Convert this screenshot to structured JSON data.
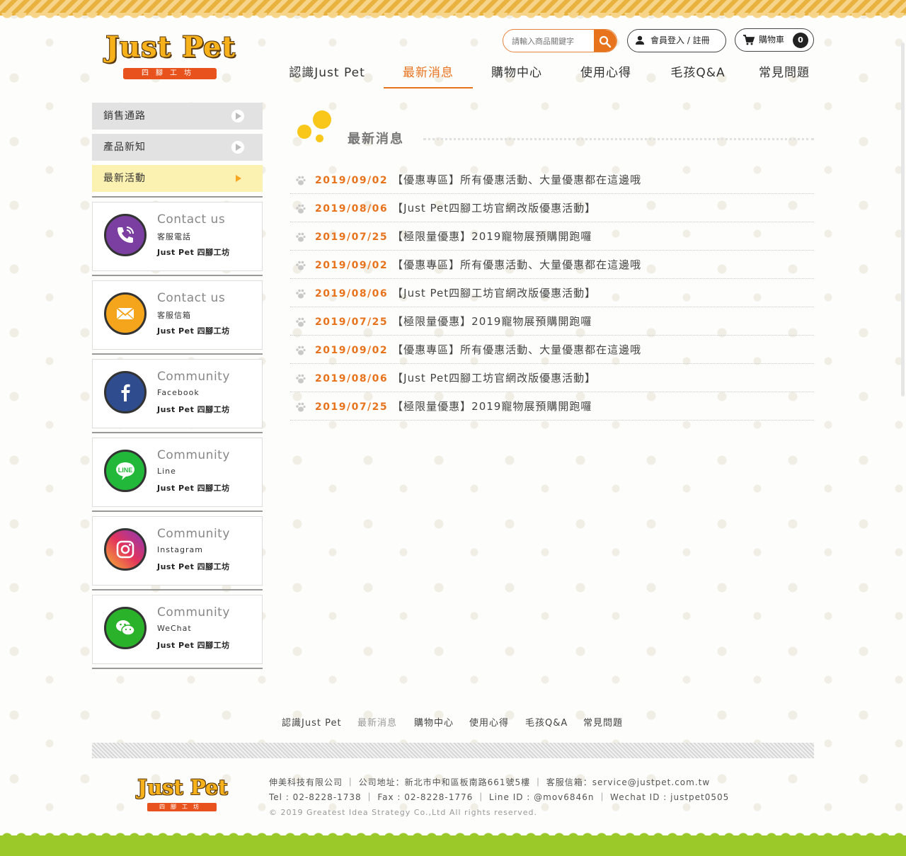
{
  "brand": {
    "logo_text": "Just Pet",
    "logo_sub": "四腳工坊"
  },
  "header": {
    "search_placeholder": "請輸入商品關鍵字",
    "login_label": "會員登入 / 註冊",
    "cart_label": "購物車",
    "cart_count": "0"
  },
  "nav": {
    "items": [
      {
        "label": "認識Just Pet"
      },
      {
        "label": "最新消息",
        "active": true
      },
      {
        "label": "購物中心"
      },
      {
        "label": "使用心得"
      },
      {
        "label": "毛孩Q&A"
      },
      {
        "label": "常見問題"
      }
    ]
  },
  "sidebar": {
    "items": [
      {
        "label": "銷售通路"
      },
      {
        "label": "產品新知"
      },
      {
        "label": "最新活動",
        "active": true
      }
    ],
    "cards": [
      {
        "title": "Contact us",
        "sub": "客服電話",
        "brand": "Just Pet 四腳工坊",
        "icon": "phone-icon",
        "color": "#7a3fa0"
      },
      {
        "title": "Contact us",
        "sub": "客服信箱",
        "brand": "Just Pet 四腳工坊",
        "icon": "mail-icon",
        "color": "#f5a51c"
      },
      {
        "title": "Community",
        "sub": "Facebook",
        "brand": "Just Pet 四腳工坊",
        "icon": "facebook-icon",
        "color": "#2f4c8e"
      },
      {
        "title": "Community",
        "sub": "Line",
        "brand": "Just Pet 四腳工坊",
        "icon": "line-icon",
        "color": "#22b83a"
      },
      {
        "title": "Community",
        "sub": "Instagram",
        "brand": "Just Pet 四腳工坊",
        "icon": "instagram-icon",
        "color": "#d6336c"
      },
      {
        "title": "Community",
        "sub": "WeChat",
        "brand": "Just Pet 四腳工坊",
        "icon": "wechat-icon",
        "color": "#2ab22a"
      }
    ]
  },
  "content": {
    "section_title": "最新消息",
    "news": [
      {
        "date": "2019/09/02",
        "title": "【優惠專區】所有優惠活動、大量優惠都在這邊哦"
      },
      {
        "date": "2019/08/06",
        "title": "【Just Pet四腳工坊官網改版優惠活動】"
      },
      {
        "date": "2019/07/25",
        "title": "【極限量優惠】2019寵物展預購開跑囉"
      },
      {
        "date": "2019/09/02",
        "title": "【優惠專區】所有優惠活動、大量優惠都在這邊哦"
      },
      {
        "date": "2019/08/06",
        "title": "【Just Pet四腳工坊官網改版優惠活動】"
      },
      {
        "date": "2019/07/25",
        "title": "【極限量優惠】2019寵物展預購開跑囉"
      },
      {
        "date": "2019/09/02",
        "title": "【優惠專區】所有優惠活動、大量優惠都在這邊哦"
      },
      {
        "date": "2019/08/06",
        "title": "【Just Pet四腳工坊官網改版優惠活動】"
      },
      {
        "date": "2019/07/25",
        "title": "【極限量優惠】2019寵物展預購開跑囉"
      }
    ]
  },
  "footer": {
    "nav": [
      {
        "label": "認識Just Pet"
      },
      {
        "label": "最新消息",
        "active": true
      },
      {
        "label": "購物中心"
      },
      {
        "label": "使用心得"
      },
      {
        "label": "毛孩Q&A"
      },
      {
        "label": "常見問題"
      }
    ],
    "line1": "伸美科技有限公司 ｜ 公司地址：新北市中和區板南路661號5樓 ｜ 客服信箱：service@justpet.com.tw",
    "line2": "Tel : 02-8228-1738 ｜ Fax : 02-8228-1776 ｜ Line ID : @mov6846n ｜ Wechat ID : justpet0505",
    "copyright": "© 2019 Greatest Idea Strategy Co.,Ltd All rights reserved.",
    "logo_text": "Just Pet",
    "logo_sub": "四腳工坊"
  },
  "colors": {
    "accent": "#e8731d",
    "yellow": "#f8c71a",
    "grass": "#9cc92a"
  }
}
